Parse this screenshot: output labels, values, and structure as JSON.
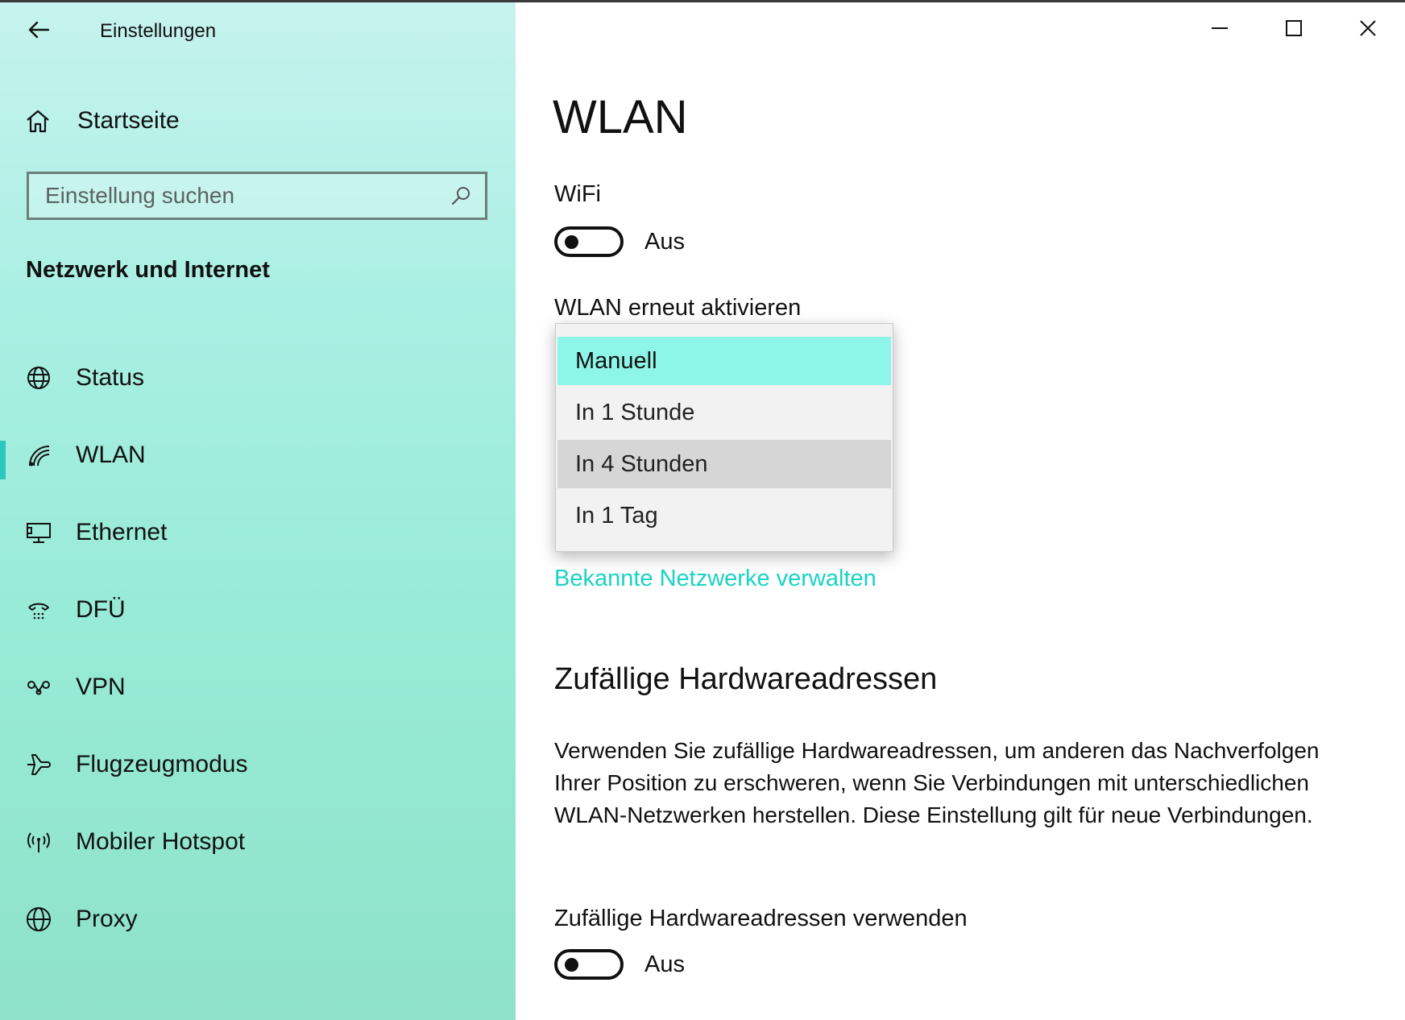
{
  "window": {
    "title": "Einstellungen",
    "controls": {
      "minimize": "minimize-icon",
      "maximize": "maximize-icon",
      "close": "close-icon"
    }
  },
  "sidebar": {
    "home_label": "Startseite",
    "search": {
      "placeholder": "Einstellung suchen",
      "value": ""
    },
    "section_title": "Netzwerk und Internet",
    "items": [
      {
        "label": "Status",
        "icon": "globe-status-icon",
        "active": false
      },
      {
        "label": "WLAN",
        "icon": "wifi-icon",
        "active": true
      },
      {
        "label": "Ethernet",
        "icon": "ethernet-icon",
        "active": false
      },
      {
        "label": "DFÜ",
        "icon": "dialup-icon",
        "active": false
      },
      {
        "label": "VPN",
        "icon": "vpn-icon",
        "active": false
      },
      {
        "label": "Flugzeugmodus",
        "icon": "airplane-icon",
        "active": false
      },
      {
        "label": "Mobiler Hotspot",
        "icon": "hotspot-icon",
        "active": false
      },
      {
        "label": "Proxy",
        "icon": "globe-icon",
        "active": false
      }
    ]
  },
  "main": {
    "title": "WLAN",
    "wifi": {
      "label": "WiFi",
      "state": "Aus"
    },
    "reactivate": {
      "label": "WLAN erneut aktivieren",
      "options": [
        "Manuell",
        "In 1 Stunde",
        "In 4 Stunden",
        "In 1 Tag"
      ],
      "selected": "Manuell",
      "hovered": "In 4 Stunden"
    },
    "manage_link": "Bekannte Netzwerke verwalten",
    "random_hw": {
      "heading": "Zufällige Hardwareadressen",
      "description": "Verwenden Sie zufällige Hardwareadressen, um anderen das Nachverfolgen Ihrer Position zu erschweren, wenn Sie Verbindungen mit unterschiedlichen WLAN-Netzwerken herstellen. Diese Einstellung gilt für neue Verbindungen.",
      "toggle_label": "Zufällige Hardwareadressen verwenden",
      "state": "Aus"
    }
  },
  "colors": {
    "accent": "#19d3c5",
    "selected_option": "#8ef6e8",
    "hover_option": "#d6d6d6",
    "sidebar_top": "#c6f3ee",
    "sidebar_bottom": "#8fe2c9"
  }
}
